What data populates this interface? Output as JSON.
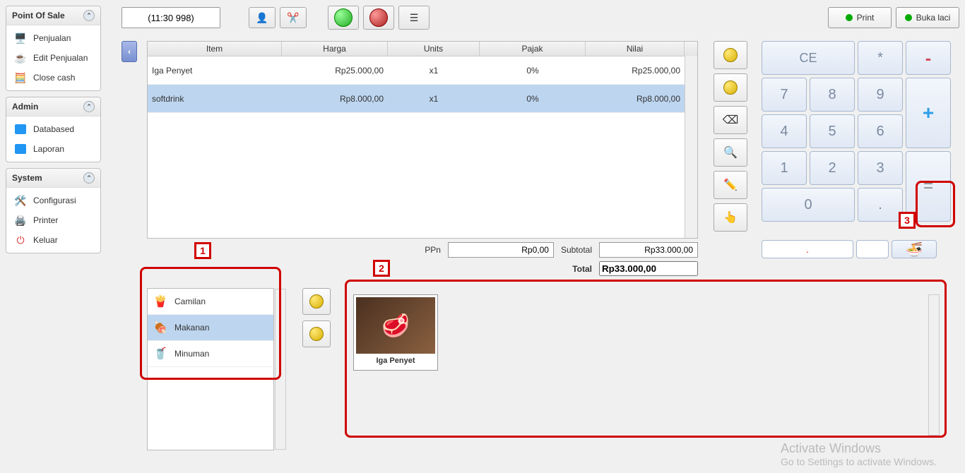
{
  "topbar": {
    "time_value": "(11:30 998)",
    "print_label": "Print",
    "drawer_label": "Buka laci"
  },
  "sidebar": {
    "pos": {
      "title": "Point Of Sale",
      "items": [
        {
          "label": "Penjualan"
        },
        {
          "label": "Edit Penjualan"
        },
        {
          "label": "Close cash"
        }
      ]
    },
    "admin": {
      "title": "Admin",
      "items": [
        {
          "label": "Databased"
        },
        {
          "label": "Laporan"
        }
      ]
    },
    "system": {
      "title": "System",
      "items": [
        {
          "label": "Configurasi"
        },
        {
          "label": "Printer"
        },
        {
          "label": "Keluar"
        }
      ]
    }
  },
  "table": {
    "headers": {
      "item": "Item",
      "harga": "Harga",
      "units": "Units",
      "pajak": "Pajak",
      "nilai": "Nilai"
    },
    "rows": [
      {
        "item": "Iga Penyet",
        "harga": "Rp25.000,00",
        "units": "x1",
        "pajak": "0%",
        "nilai": "Rp25.000,00"
      },
      {
        "item": "softdrink",
        "harga": "Rp8.000,00",
        "units": "x1",
        "pajak": "0%",
        "nilai": "Rp8.000,00"
      }
    ]
  },
  "totals": {
    "ppn_label": "PPn",
    "ppn_value": "Rp0,00",
    "subtotal_label": "Subtotal",
    "subtotal_value": "Rp33.000,00",
    "total_label": "Total",
    "total_value": "Rp33.000,00"
  },
  "keypad": {
    "ce": "CE",
    "star": "*",
    "minus": "-",
    "plus": "+",
    "eq": "=",
    "n7": "7",
    "n8": "8",
    "n9": "9",
    "n4": "4",
    "n5": "5",
    "n6": "6",
    "n1": "1",
    "n2": "2",
    "n3": "3",
    "n0": "0",
    "dot": "."
  },
  "categories": [
    {
      "label": "Camilan"
    },
    {
      "label": "Makanan"
    },
    {
      "label": "Minuman"
    }
  ],
  "product": {
    "name": "Iga Penyet"
  },
  "annotations": {
    "a1": "1",
    "a2": "2",
    "a3": "3"
  },
  "watermark": {
    "line1": "Activate Windows",
    "line2": "Go to Settings to activate Windows."
  }
}
